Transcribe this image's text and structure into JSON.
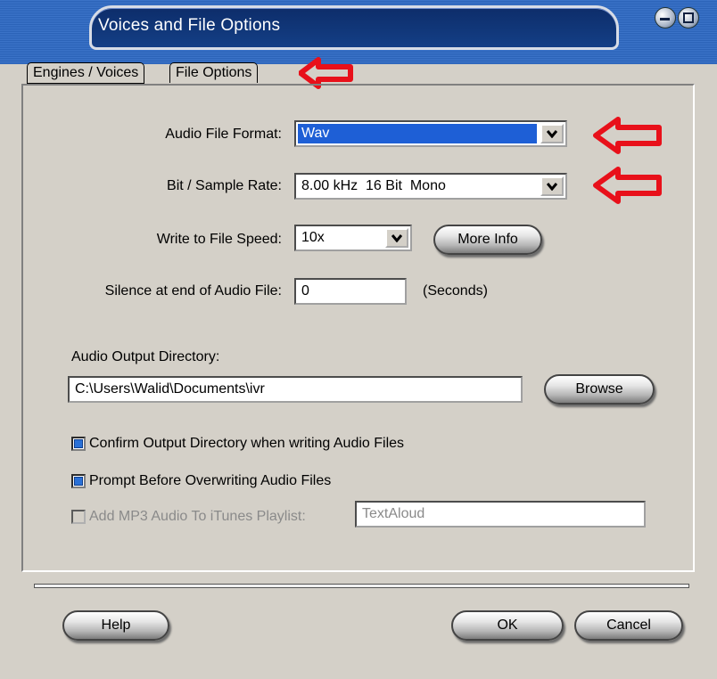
{
  "window": {
    "title": "Voices and File Options",
    "minimize_icon": "minimize-icon",
    "maximize_icon": "maximize-icon"
  },
  "tabs": [
    {
      "label": "Engines / Voices",
      "active": false
    },
    {
      "label": "File Options",
      "active": true
    }
  ],
  "form": {
    "audio_format": {
      "label": "Audio File Format:",
      "value": "Wav"
    },
    "bit_rate": {
      "label": "Bit / Sample Rate:",
      "value": "8.00 kHz  16 Bit  Mono"
    },
    "speed": {
      "label": "Write to File Speed:",
      "value": "10x",
      "more_info_label": "More Info"
    },
    "silence": {
      "label": "Silence at end of Audio File:",
      "value": "0",
      "unit": "(Seconds)"
    },
    "output_dir": {
      "label": "Audio Output Directory:",
      "value": "C:\\Users\\Walid\\Documents\\ivr",
      "browse_label": "Browse"
    },
    "confirm_dir": {
      "label": "Confirm Output Directory when writing Audio Files",
      "checked": true
    },
    "prompt_overwrite": {
      "label": "Prompt Before Overwriting Audio Files",
      "checked": true
    },
    "itunes": {
      "label": "Add MP3 Audio To iTunes Playlist:",
      "checked": false,
      "enabled": false,
      "playlist": "TextAloud"
    }
  },
  "buttons": {
    "help": "Help",
    "ok": "OK",
    "cancel": "Cancel"
  },
  "colors": {
    "title_bar": "#2b63b8",
    "selection": "#1e5fd6",
    "annotation_arrow": "#e8101a"
  }
}
